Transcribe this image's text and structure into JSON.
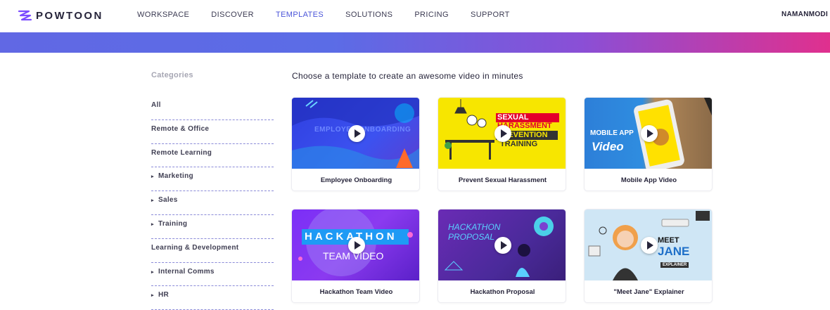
{
  "brand": {
    "name": "POWTOON"
  },
  "nav": {
    "items": [
      {
        "label": "WORKSPACE",
        "active": false
      },
      {
        "label": "DISCOVER",
        "active": false
      },
      {
        "label": "TEMPLATES",
        "active": true
      },
      {
        "label": "SOLUTIONS",
        "active": false
      },
      {
        "label": "PRICING",
        "active": false
      },
      {
        "label": "SUPPORT",
        "active": false
      }
    ],
    "user": "NAMANMODI"
  },
  "colors": {
    "accent": "#4b55d9",
    "banner_start": "#6168e4",
    "banner_end": "#e0308e"
  },
  "sidebar": {
    "title": "Categories",
    "items": [
      {
        "label": "All",
        "expandable": false
      },
      {
        "label": "Remote & Office",
        "expandable": false
      },
      {
        "label": "Remote Learning",
        "expandable": false
      },
      {
        "label": "Marketing",
        "expandable": true
      },
      {
        "label": "Sales",
        "expandable": true
      },
      {
        "label": "Training",
        "expandable": true
      },
      {
        "label": "Learning & Development",
        "expandable": false
      },
      {
        "label": "Internal Comms",
        "expandable": true
      },
      {
        "label": "HR",
        "expandable": true
      }
    ]
  },
  "main": {
    "heading": "Choose a template to create an awesome video in minutes",
    "templates": [
      {
        "label": "Employee Onboarding",
        "thumb_text": "EMPLOYEE ONBOARDING",
        "icon": "play-icon"
      },
      {
        "label": "Prevent Sexual Harassment",
        "thumb_text": [
          "SEXUAL",
          "HARASSMENT",
          "PREVENTION",
          "TRAINING"
        ],
        "icon": "play-icon"
      },
      {
        "label": "Mobile App Video",
        "thumb_text": [
          "MOBILE APP",
          "Video"
        ],
        "icon": "play-icon"
      },
      {
        "label": "Hackathon Team Video",
        "thumb_text": [
          "HACKATHON",
          "TEAM VIDEO"
        ],
        "icon": "play-icon"
      },
      {
        "label": "Hackathon Proposal",
        "thumb_text": [
          "HACKATHON",
          "PROPOSAL"
        ],
        "icon": "play-icon"
      },
      {
        "label": "\"Meet Jane\" Explainer",
        "thumb_text": [
          "MEET",
          "JANE",
          "EXPLAINER"
        ],
        "icon": "play-icon"
      }
    ]
  }
}
